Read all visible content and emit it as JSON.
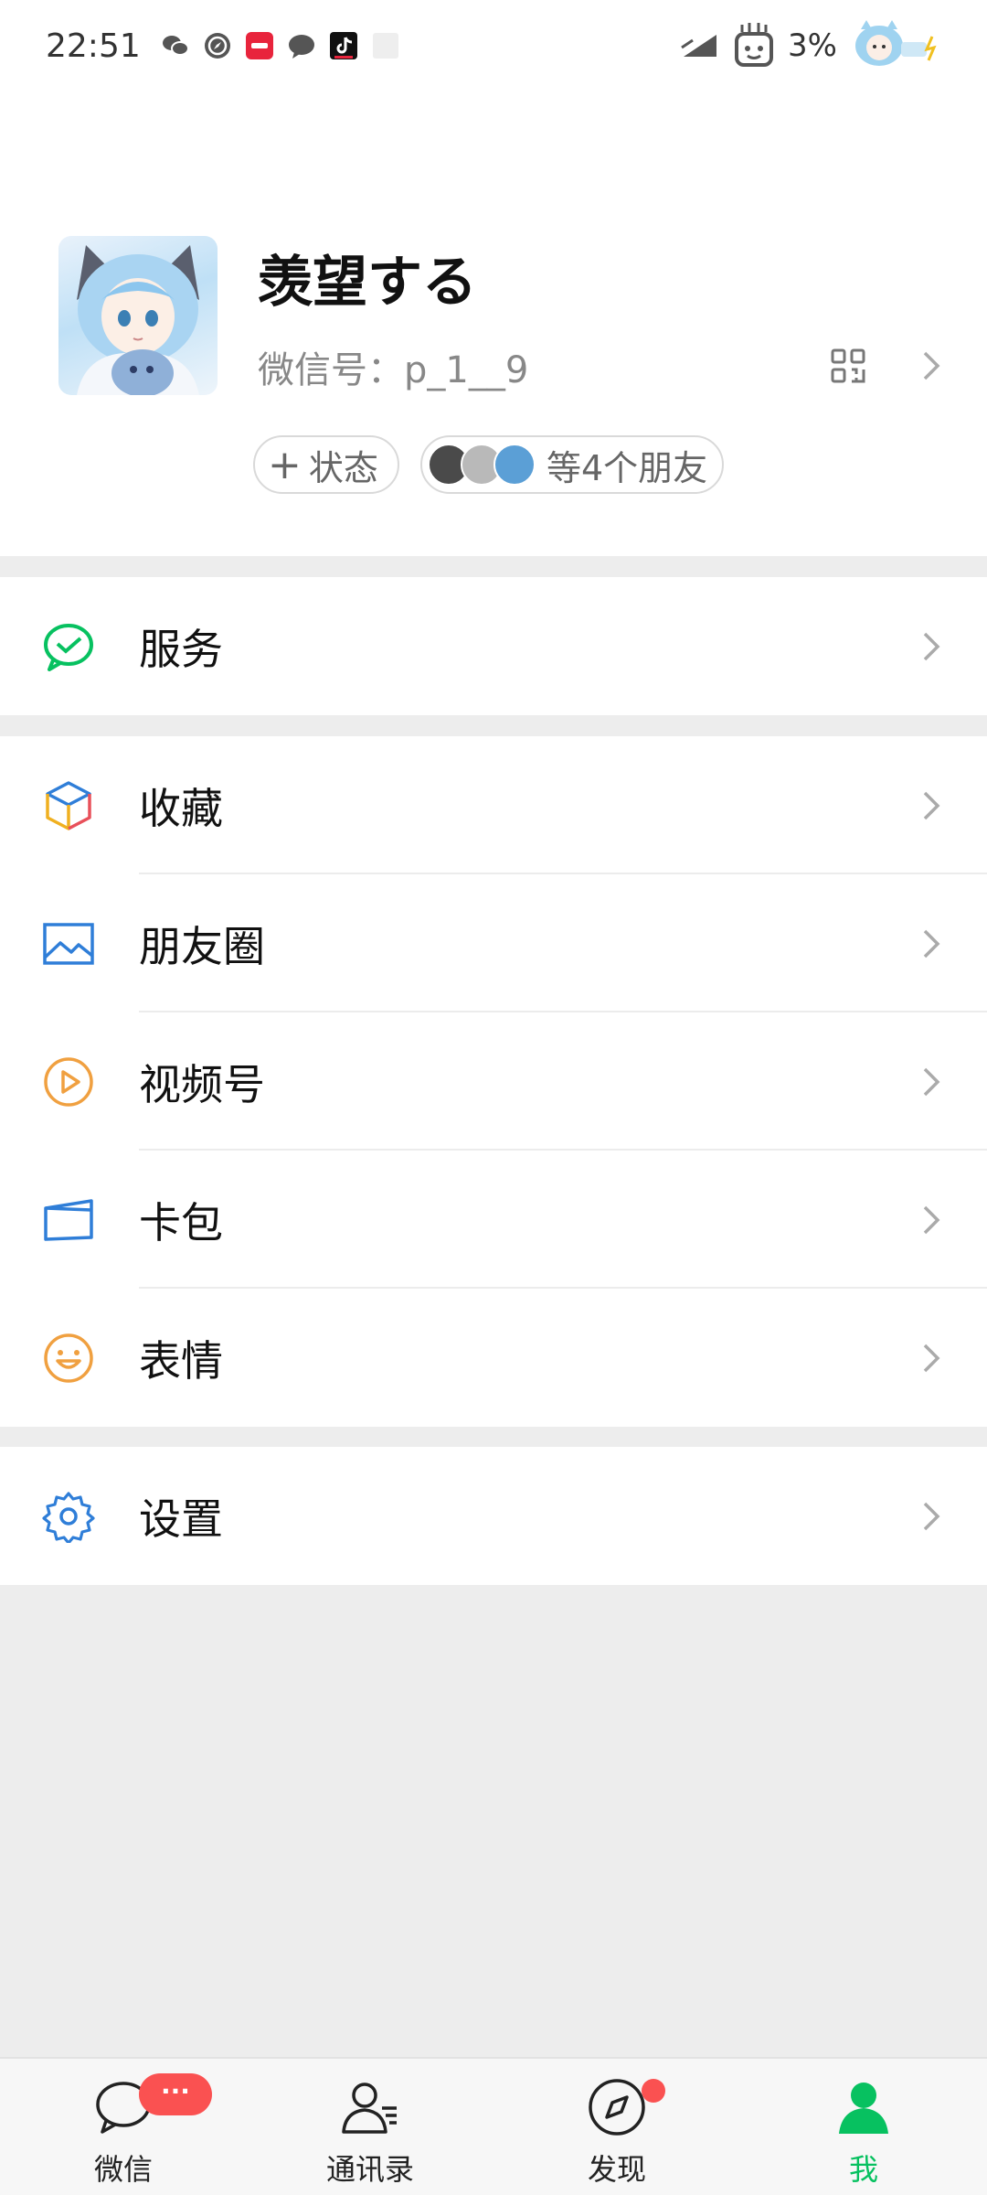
{
  "status_bar": {
    "time": "22:51",
    "battery": "3%",
    "notification_icons": [
      "wechat-icon",
      "compass-app-icon",
      "xiaohongshu-icon",
      "message-icon",
      "tiktok-icon",
      "blank-app-icon"
    ],
    "right_icons": [
      "signal-icon",
      "robot-mascot-icon",
      "anime-girl-battery-icon"
    ]
  },
  "profile": {
    "nickname": "羡望する",
    "wechat_id": "微信号：p_1__9",
    "status_button": "状态",
    "friends_pill": "等4个朋友"
  },
  "menu": {
    "service": {
      "label": "服务",
      "icon": "service-icon",
      "color": "#07c160"
    },
    "favorites": {
      "label": "收藏",
      "icon": "cube-icon"
    },
    "moments": {
      "label": "朋友圈",
      "icon": "picture-icon",
      "color": "#2f7ed8"
    },
    "channels": {
      "label": "视频号",
      "icon": "play-circle-icon",
      "color": "#f0a040"
    },
    "cards": {
      "label": "卡包",
      "icon": "wallet-icon",
      "color": "#2f7ed8"
    },
    "stickers": {
      "label": "表情",
      "icon": "smile-icon",
      "color": "#f0a040"
    },
    "settings": {
      "label": "设置",
      "icon": "gear-icon",
      "color": "#2f7ed8"
    }
  },
  "tabbar": {
    "chats": {
      "label": "微信",
      "badge": "···"
    },
    "contacts": {
      "label": "通讯录"
    },
    "discover": {
      "label": "发现"
    },
    "me": {
      "label": "我"
    },
    "active_color": "#07c160",
    "badge_color": "#fa5151"
  }
}
